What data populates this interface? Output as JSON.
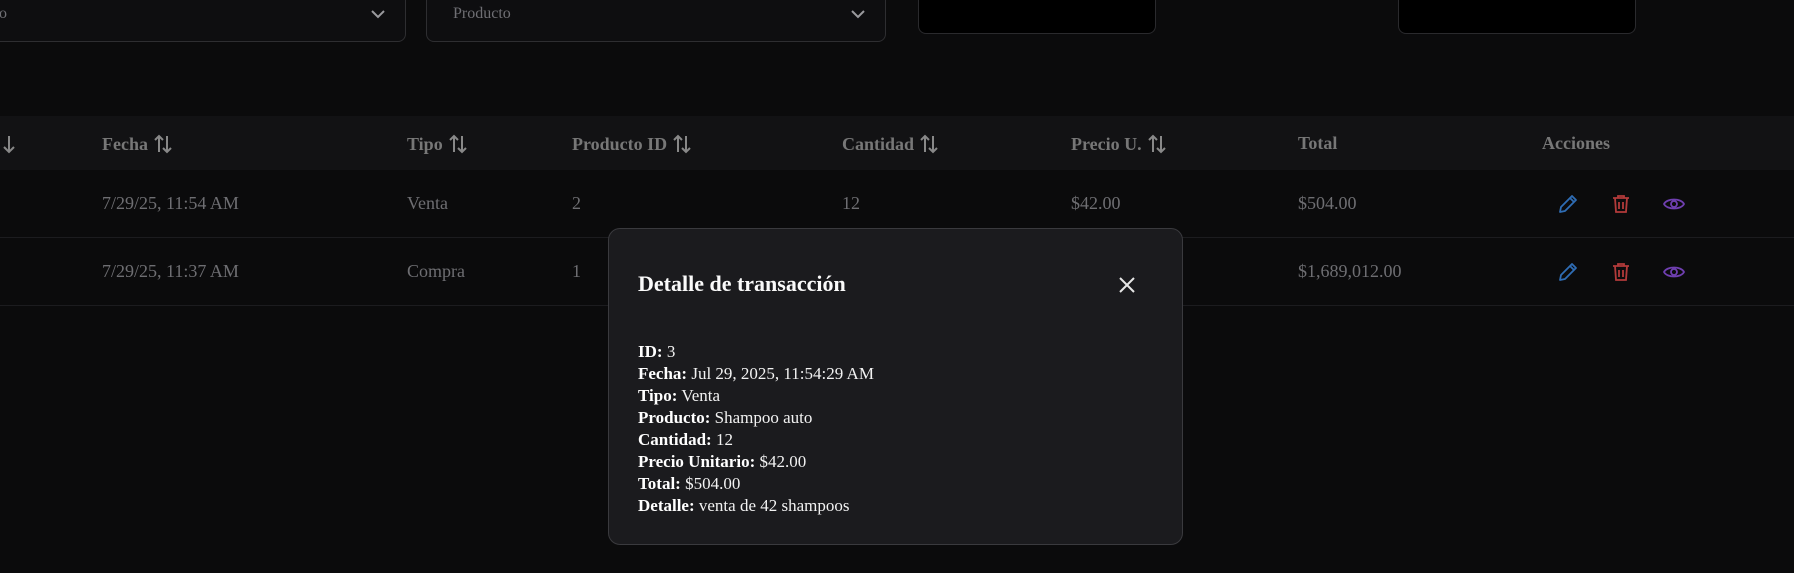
{
  "filters": {
    "first_select_partial": "o",
    "product_select_placeholder": "Producto"
  },
  "table": {
    "columns": [
      {
        "label": "Fecha",
        "sortable": true
      },
      {
        "label": "Tipo",
        "sortable": true
      },
      {
        "label": "Producto ID",
        "sortable": true
      },
      {
        "label": "Cantidad",
        "sortable": true
      },
      {
        "label": "Precio U.",
        "sortable": true
      },
      {
        "label": "Total",
        "sortable": false
      },
      {
        "label": "Acciones",
        "sortable": false
      }
    ],
    "rows": [
      {
        "fecha": "7/29/25, 11:54 AM",
        "tipo": "Venta",
        "producto_id": "2",
        "cantidad": "12",
        "precio": "$42.00",
        "total": "$504.00"
      },
      {
        "fecha": "7/29/25, 11:37 AM",
        "tipo": "Compra",
        "producto_id": "1",
        "cantidad": "",
        "precio": "",
        "total": "$1,689,012.00"
      }
    ],
    "action_icons": [
      "edit-icon",
      "trash-icon",
      "eye-icon"
    ]
  },
  "modal": {
    "title": "Detalle de transacción",
    "fields": [
      {
        "label": "ID:",
        "value": "3"
      },
      {
        "label": "Fecha:",
        "value": "Jul 29, 2025, 11:54:29 AM"
      },
      {
        "label": "Tipo:",
        "value": "Venta"
      },
      {
        "label": "Producto:",
        "value": "Shampoo auto"
      },
      {
        "label": "Cantidad:",
        "value": "12"
      },
      {
        "label": "Precio Unitario:",
        "value": "$42.00"
      },
      {
        "label": "Total:",
        "value": "$504.00"
      },
      {
        "label": "Detalle:",
        "value": "venta de 42 shampoos"
      }
    ]
  },
  "colors": {
    "background": "#0b0b0c",
    "modal_bg": "#1b1b1e",
    "edit": "#2f6db5",
    "delete": "#b23a3a",
    "view": "#6f3fb0"
  }
}
